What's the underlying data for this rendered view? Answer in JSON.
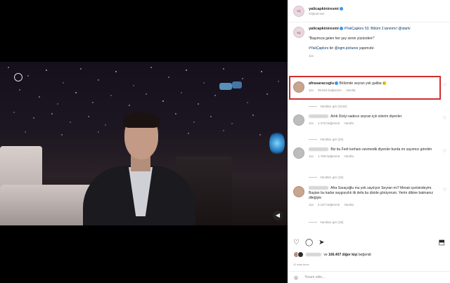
{
  "post": {
    "header": {
      "username": "yalicapkiniresmi",
      "subtitle": "Orijinal ses"
    },
    "caption": {
      "username": "yalicapkiniresmi",
      "line1": "#YalıÇapkını 53. Bölüm 2.tanıtımı! @startv",
      "line2": "\"Başımıza gelen her şey senin yüzünden!\"",
      "line3_link": "#YalıÇapkını",
      "line3_mid": " bir ",
      "line3_mention": "@ogm.pictures",
      "line3_end": " yapımıdır.",
      "time": "11s"
    },
    "comments": [
      {
        "username": "afrasaracoglu",
        "text": "Bölümde seyran yok galiba 😢",
        "time": "11s",
        "likes": "39.816 beğenme",
        "reply": "Yanıtla",
        "replies": "Yanıtları gör (2215)"
      },
      {
        "text": "Artık Diziyi sadece seyran için izlerim diyenler",
        "time": "11s",
        "likes": "1.276 beğenme",
        "reply": "Yanıtla",
        "replies": "Yanıtları gör (32)"
      },
      {
        "text": "Biz bu Ferit korhanı sevmedik diyenler burda mı sayımızı görelim",
        "time": "11s",
        "likes": "1.788 beğenme",
        "reply": "Yanıtla",
        "replies": "Yanıtları gör (15)"
      },
      {
        "text": "Afra Saraçoğlu mu yok sayılıyor Seyran mı? Merak içerisindeyim. Baştan bu kadar saygısızlık ilk defa bu dizide görüyorum. Yerim dibine batmanız dileğiyle",
        "time": "11s",
        "likes": "2.167 beğenme",
        "reply": "Yanıtla",
        "replies": "Yanıtları gör (19)"
      }
    ],
    "likes_text_prefix": "ve ",
    "likes_count": "166.407 diğer kişi",
    "likes_text_suffix": " beğendi",
    "time_ago": "11 saat önce",
    "add_comment_placeholder": "Yorum ekle..."
  },
  "icons": {
    "heart": "♡",
    "comment": "◯",
    "share": "➤",
    "bookmark": "⬒",
    "emoji": "☺"
  },
  "colors": {
    "highlight": "#d22d2d",
    "link": "#00376b",
    "verified": "#3897f0"
  }
}
